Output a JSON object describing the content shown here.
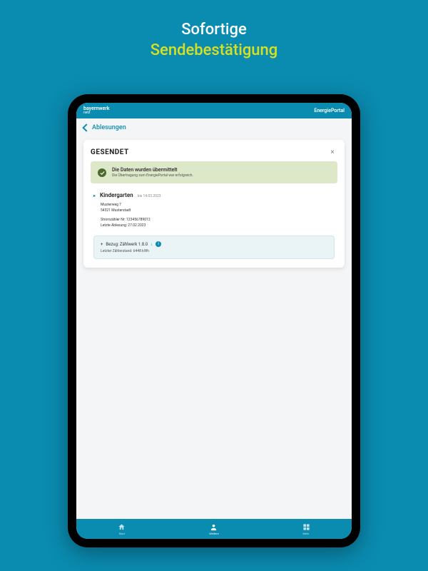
{
  "promo": {
    "line1": "Sofortige",
    "line2": "Sendebestätigung"
  },
  "appbar": {
    "brand": "bayernwerk",
    "brand_sub": "netz",
    "app_name": "EnergiePortal"
  },
  "nav_back": {
    "label": "Ablesungen"
  },
  "card": {
    "title": "GESENDET",
    "close_glyph": "×",
    "success": {
      "title": "Die Daten wurden übermittelt",
      "subtitle": "Die Übertragung zum EnergiePortal war erfolgreich."
    },
    "location": {
      "name": "Kindergarten",
      "date": "bis 14.03.2023",
      "street": "Musterweg 7",
      "city": "54321 Musterstadt",
      "meter_label": "Stromzähler Nr: 123456789012",
      "last_reading": "Letzte Ablesung: 27.02.2023"
    },
    "reading": {
      "line1_prefix": "+",
      "line1_label": "Bezug: Zählwerk 1.8.0",
      "line2": "Letzter Zählerstand: 6448 kWh"
    }
  },
  "bottomnav": {
    "items": [
      {
        "label": "Start",
        "icon": "home"
      },
      {
        "label": "Weitere",
        "icon": "user"
      },
      {
        "label": "Mehr",
        "icon": "grid"
      }
    ],
    "active_index": 1
  }
}
